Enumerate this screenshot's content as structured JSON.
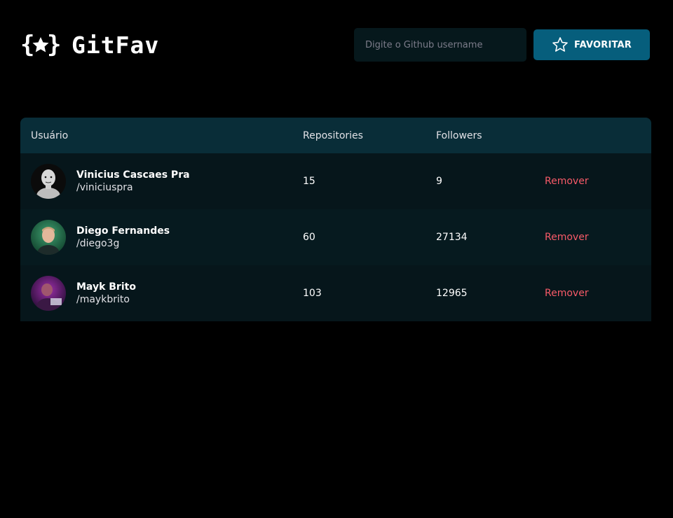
{
  "header": {
    "logo_text": "GitFav",
    "search_placeholder": "Digite o Github username",
    "favorite_label": "FAVORITAR"
  },
  "table": {
    "columns": {
      "user": "Usuário",
      "repositories": "Repositories",
      "followers": "Followers"
    },
    "rows": [
      {
        "name": "Vinicius Cascaes Pra",
        "login": "/viniciuspra",
        "repositories": "15",
        "followers": "9",
        "action": "Remover"
      },
      {
        "name": "Diego Fernandes",
        "login": "/diego3g",
        "repositories": "60",
        "followers": "27134",
        "action": "Remover"
      },
      {
        "name": "Mayk Brito",
        "login": "/maykbrito",
        "repositories": "103",
        "followers": "12965",
        "action": "Remover"
      }
    ]
  },
  "colors": {
    "background": "#000000",
    "header_row": "#092d38",
    "button": "#065e7c",
    "remove": "#f75a68"
  }
}
